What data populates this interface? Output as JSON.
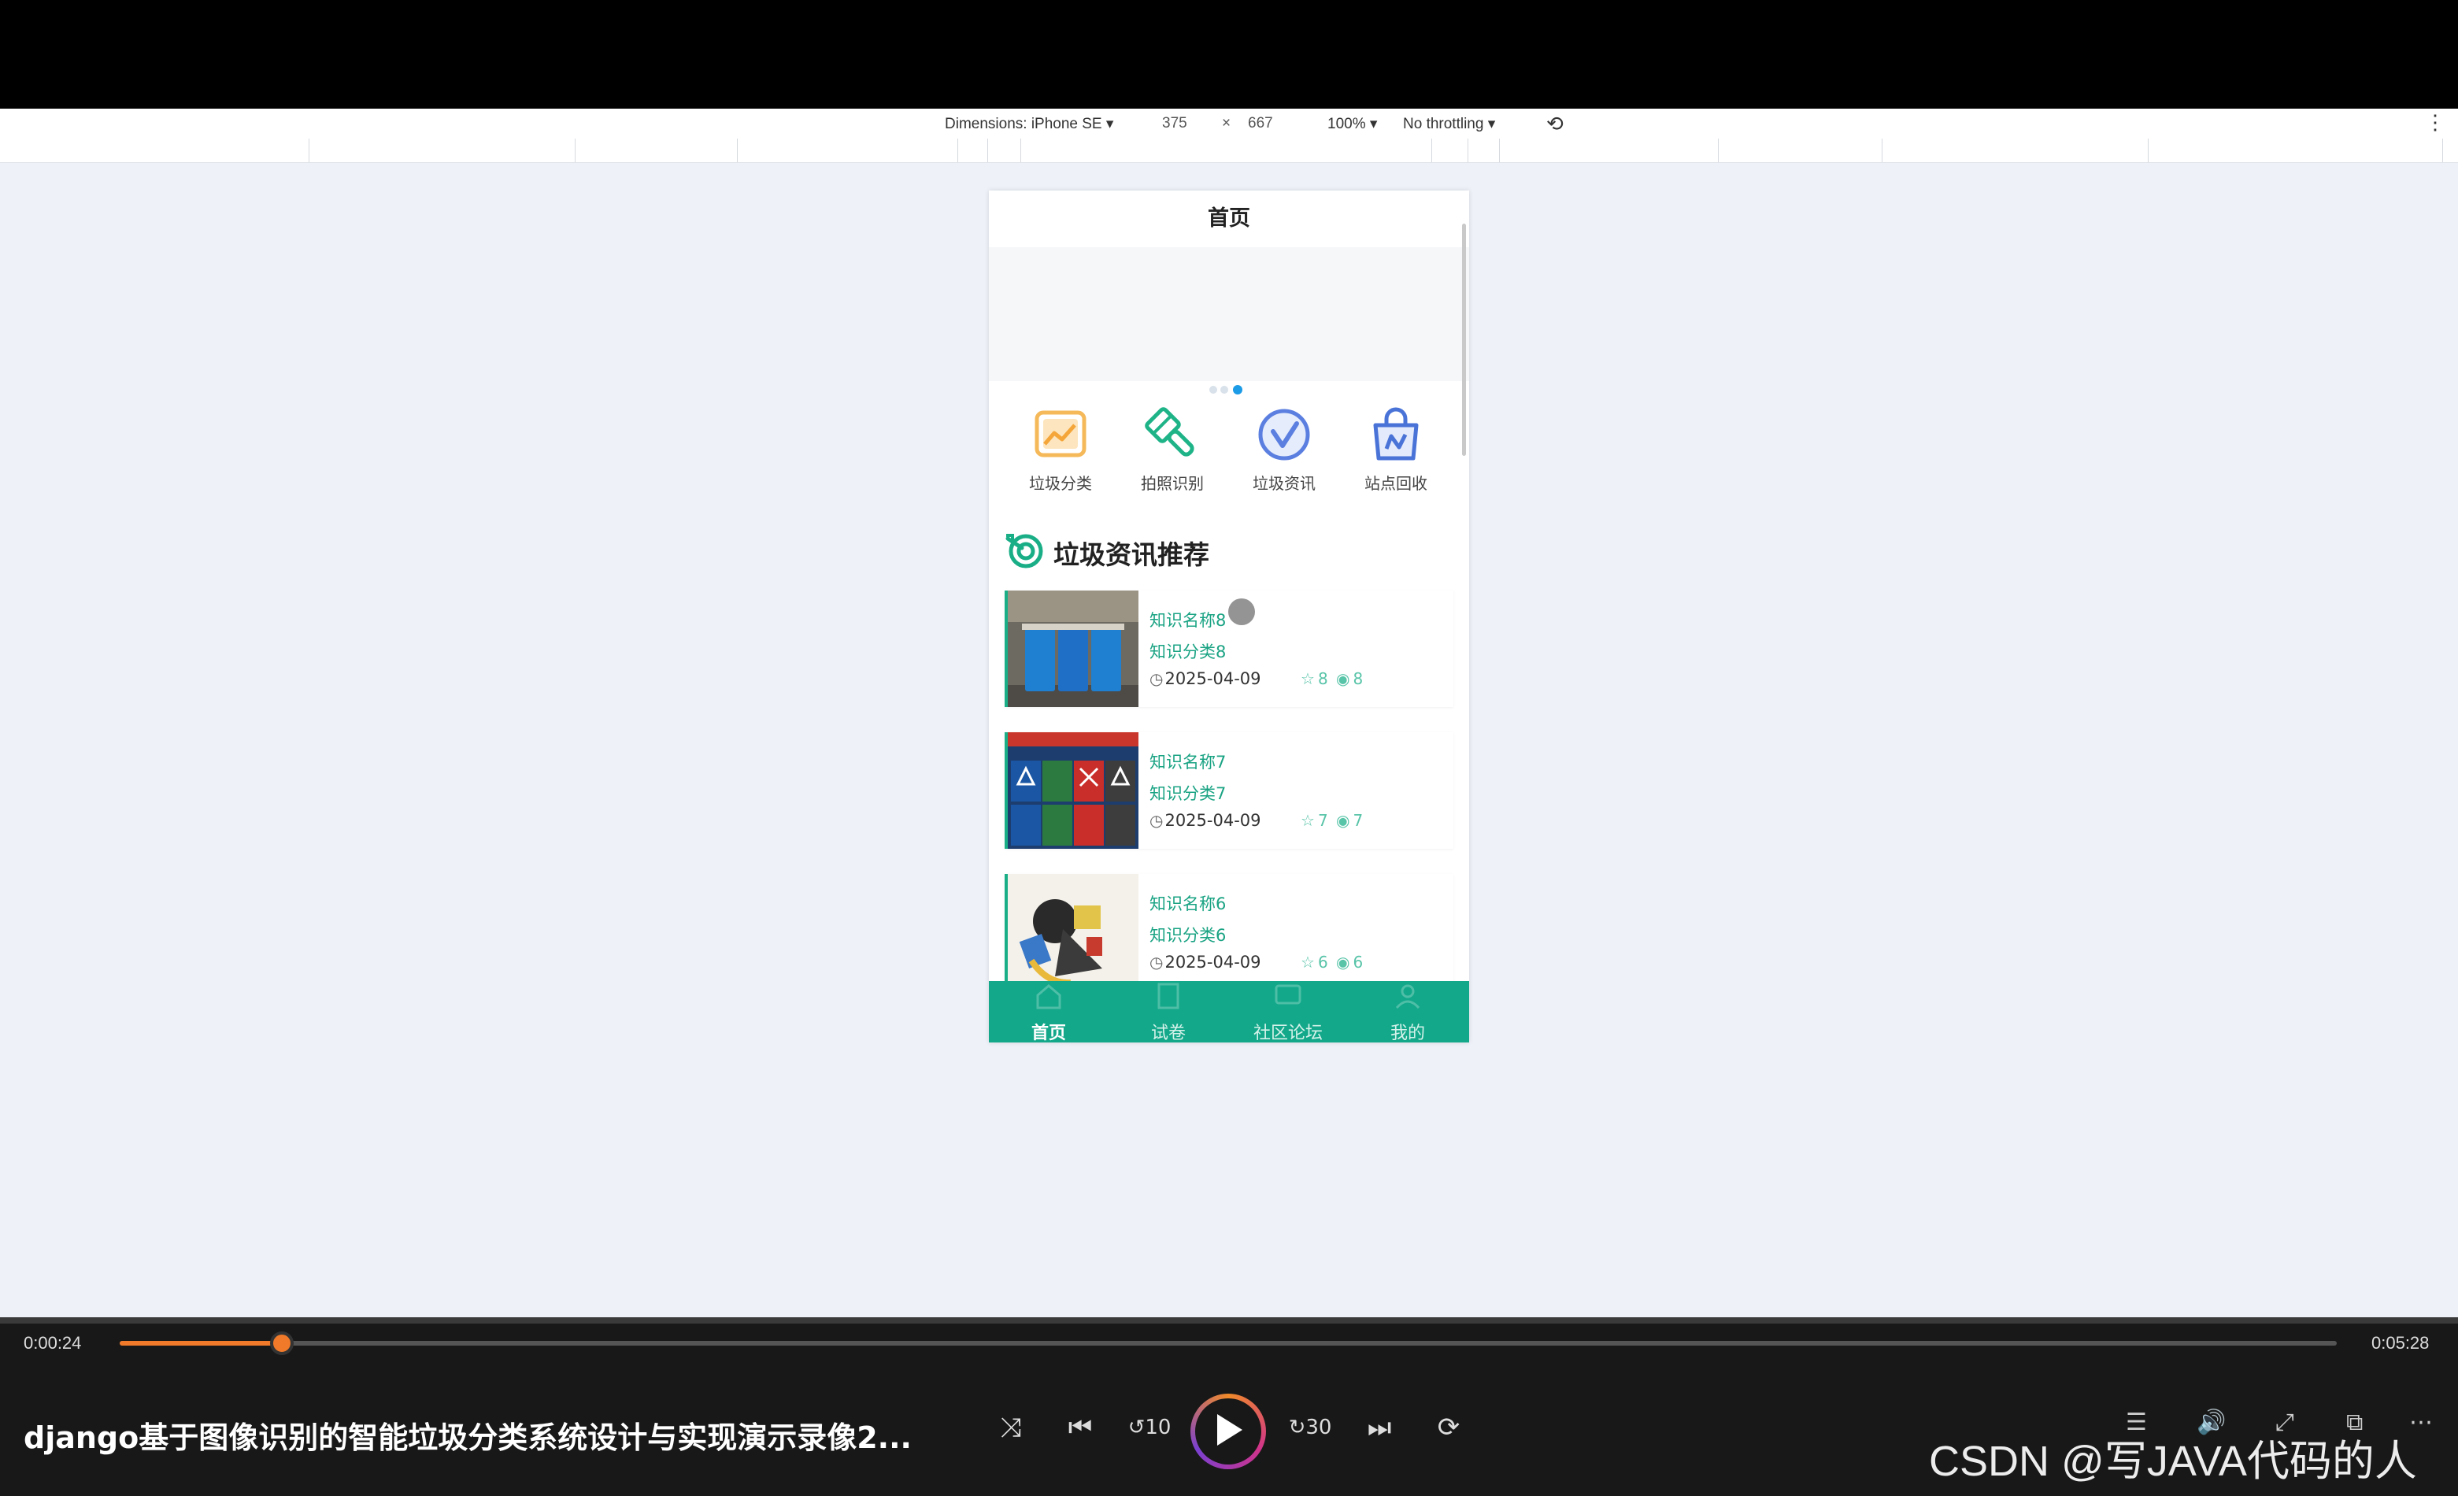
{
  "devtools": {
    "dimensions_label": "Dimensions: iPhone SE ▾",
    "width": "375",
    "times": "×",
    "height": "667",
    "zoom": "100% ▾",
    "throttling": "No throttling ▾"
  },
  "app": {
    "title": "首页",
    "banner_dots": 3,
    "active_dot": 2,
    "quick_links": [
      {
        "label": "垃圾分类",
        "icon": "chart-image-icon",
        "color": "#f5b95a"
      },
      {
        "label": "拍照识别",
        "icon": "brush-icon",
        "color": "#1fb388"
      },
      {
        "label": "垃圾资讯",
        "icon": "check-circle-icon",
        "color": "#5b7fe0"
      },
      {
        "label": "站点回收",
        "icon": "shopping-bag-icon",
        "color": "#4a73d8"
      }
    ],
    "section_title": "垃圾资讯推荐",
    "articles": [
      {
        "name": "知识名称8",
        "category": "知识分类8",
        "date": "2025-04-09",
        "stars": "8",
        "views": "8"
      },
      {
        "name": "知识名称7",
        "category": "知识分类7",
        "date": "2025-04-09",
        "stars": "7",
        "views": "7"
      },
      {
        "name": "知识名称6",
        "category": "知识分类6",
        "date": "2025-04-09",
        "stars": "6",
        "views": "6"
      }
    ],
    "tabs": [
      {
        "label": "首页",
        "active": true
      },
      {
        "label": "试卷",
        "active": false
      },
      {
        "label": "社区论坛",
        "active": false
      },
      {
        "label": "我的",
        "active": false
      }
    ],
    "accent_color": "#13a88a"
  },
  "player": {
    "current_time": "0:00:24",
    "duration": "0:05:28",
    "progress": 0.0732,
    "title": "django基于图像识别的智能垃圾分类系统设计与实现演示录像2...",
    "watermark": "CSDN @写JAVA代码的人"
  }
}
